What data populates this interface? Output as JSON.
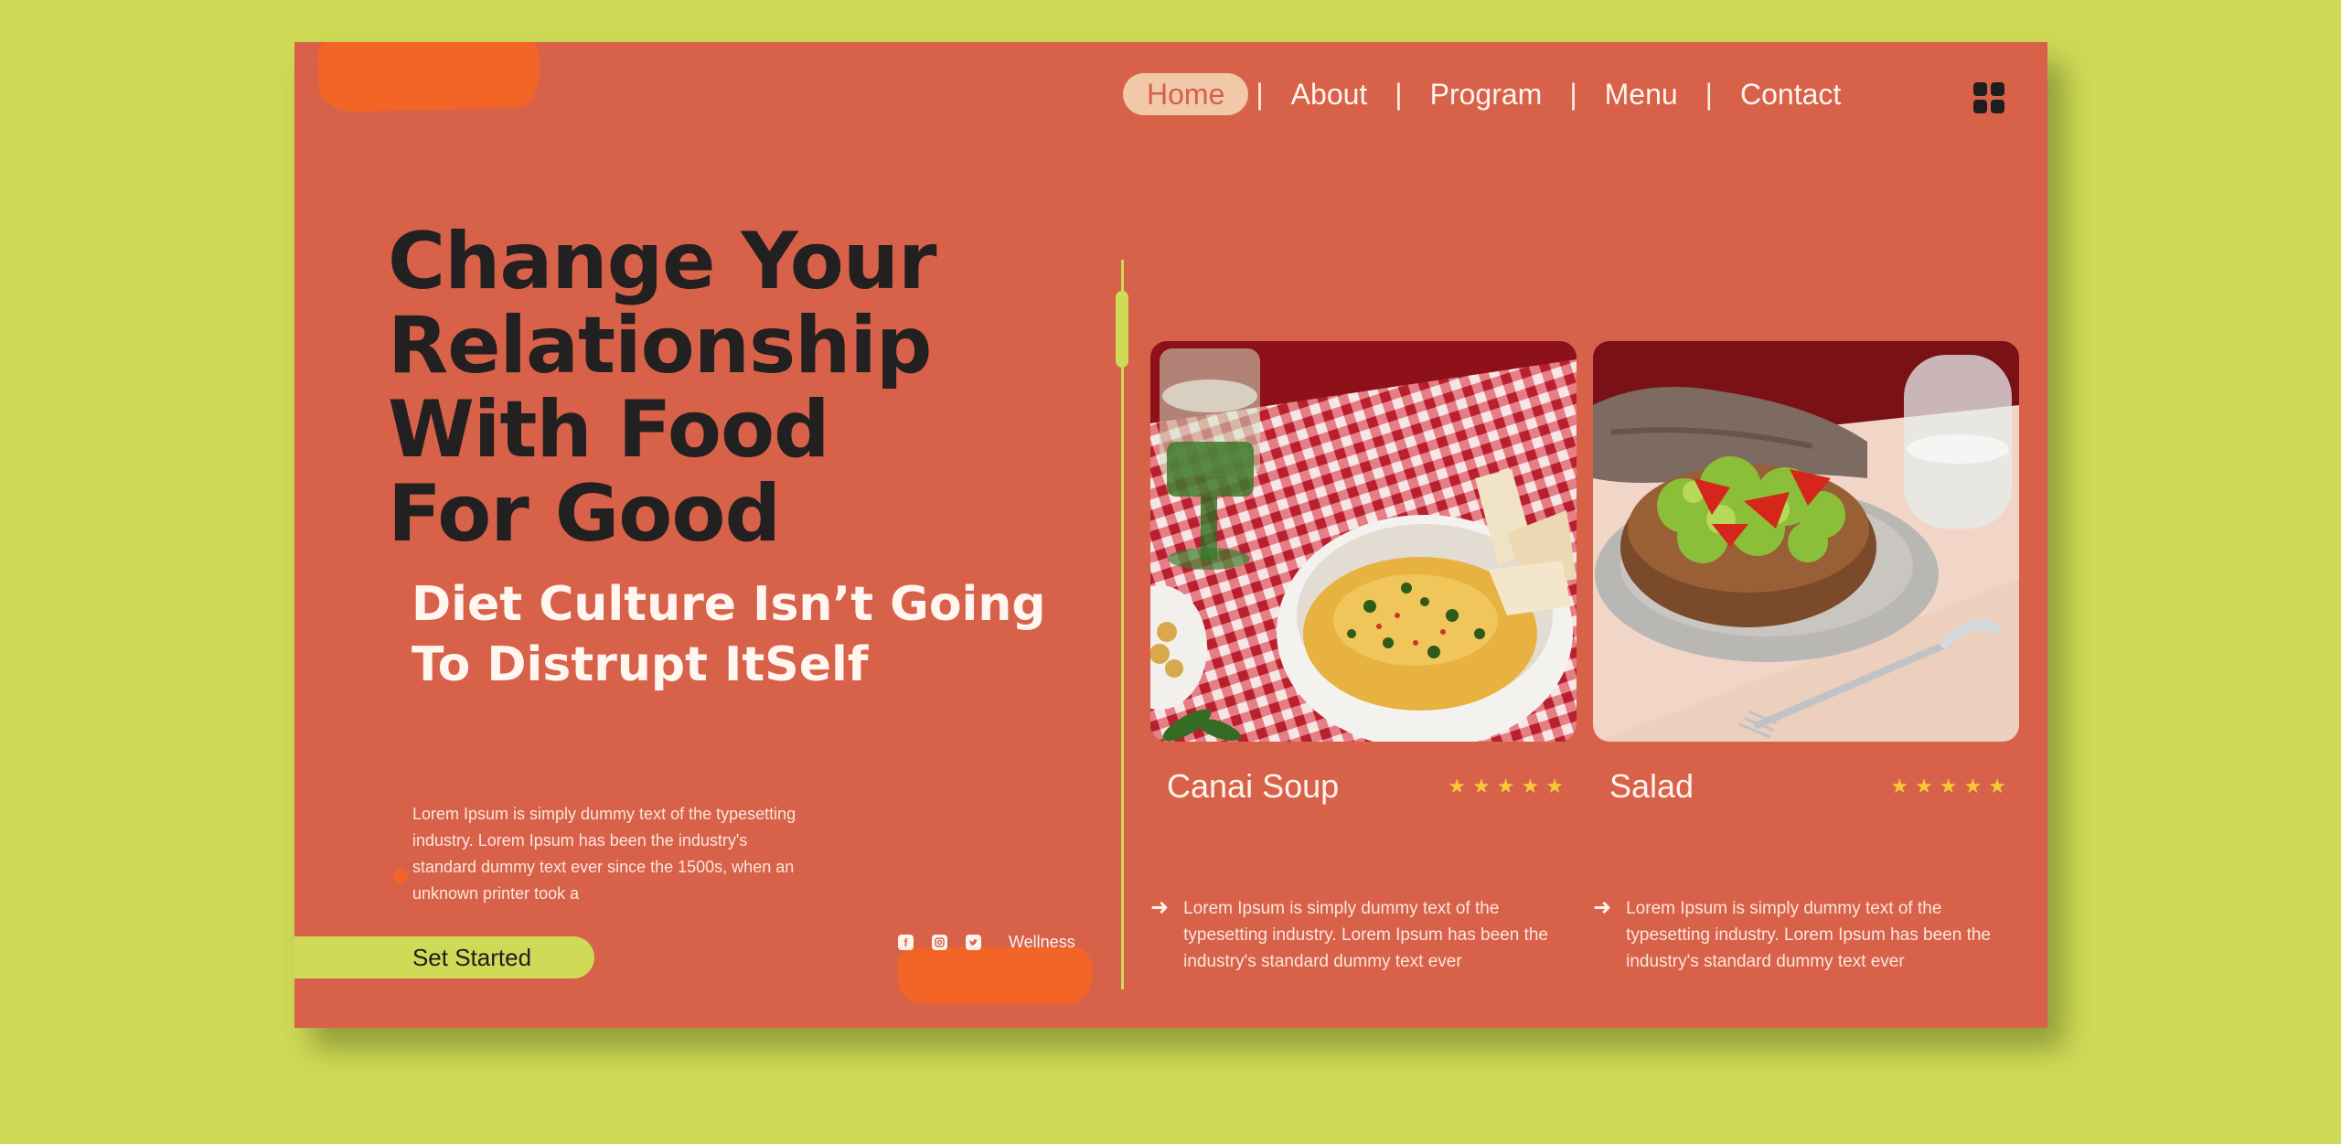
{
  "nav": {
    "items": [
      {
        "label": "Home",
        "active": true
      },
      {
        "label": "About"
      },
      {
        "label": "Program"
      },
      {
        "label": "Menu"
      },
      {
        "label": "Contact"
      }
    ],
    "separator": "|",
    "menu_icon": "grid-icon"
  },
  "hero": {
    "headline": [
      "Change Your",
      "Relationship",
      "With Food",
      "For Good"
    ],
    "subheadline": [
      "Diet Culture Isn’t Going",
      "To Distrupt ItSelf"
    ],
    "body": "Lorem Ipsum is simply dummy text of the typesetting industry. Lorem Ipsum has been the industry's standard dummy text ever since the 1500s, when an unknown printer took a",
    "cta_label": "Set Started"
  },
  "social": {
    "icons": [
      "facebook-icon",
      "instagram-icon",
      "twitter-icon"
    ],
    "label": "Wellness"
  },
  "dishes": [
    {
      "name": "Canai Soup",
      "rating": 5,
      "description": "Lorem Ipsum is simply dummy text of the typesetting industry. Lorem Ipsum has been the industry's standard dummy text ever"
    },
    {
      "name": "Salad",
      "rating": 5,
      "description": "Lorem Ipsum is simply dummy text of the typesetting industry. Lorem Ipsum has been the industry's standard dummy text ever"
    }
  ],
  "colors": {
    "background": "#cfdb57",
    "card": "#d8614a",
    "accent": "#f26526",
    "nav_active": "#f1c9a8",
    "star": "#f6c93a",
    "heading": "#222020"
  }
}
